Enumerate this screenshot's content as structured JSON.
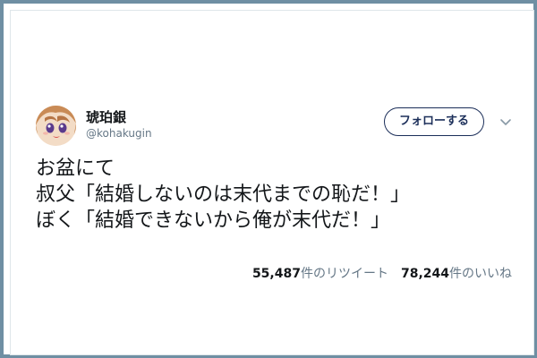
{
  "profile": {
    "display_name": "琥珀銀",
    "handle": "@kohakugin"
  },
  "header": {
    "follow_label": "フォローする"
  },
  "tweet": {
    "lines": [
      "お盆にて",
      "叔父「結婚しないのは末代までの恥だ！」",
      "ぼく「結婚できないから俺が末代だ！」"
    ]
  },
  "stats": {
    "retweets_count": "55,487",
    "retweets_label": "件のリツイート",
    "likes_count": "78,244",
    "likes_label": "件のいいね"
  },
  "icons": {
    "avatar": "avatar",
    "more": "chevron-down-icon"
  },
  "colors": {
    "frame": "#6f8fa3",
    "follow_border": "#1b2e59",
    "muted_text": "#657786"
  }
}
